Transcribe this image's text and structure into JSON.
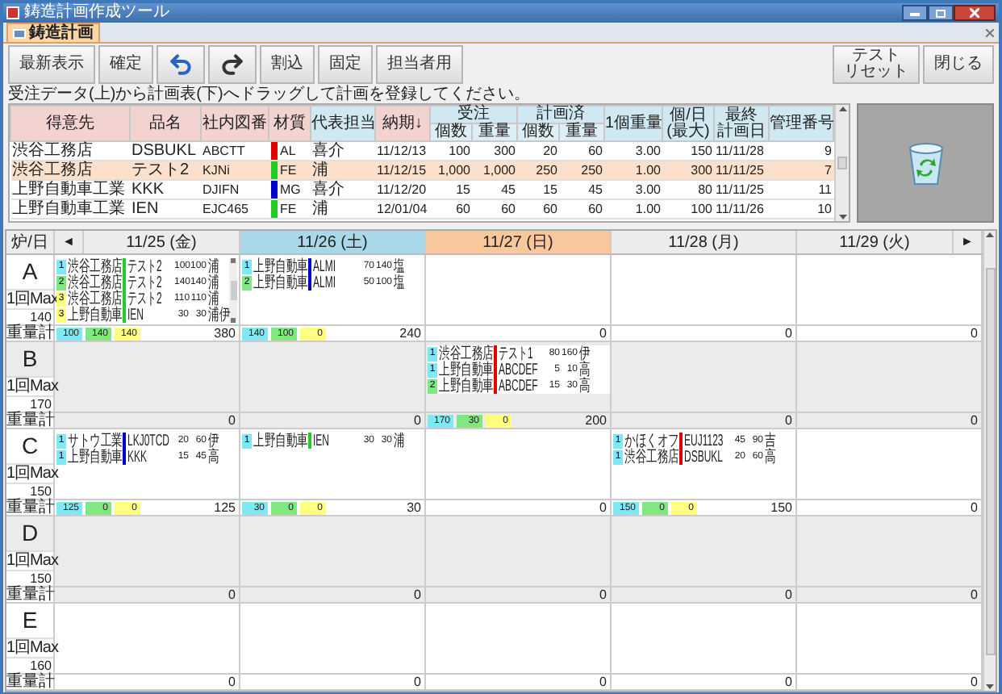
{
  "window": {
    "title": "鋳造計画作成ツール"
  },
  "tabs": [
    {
      "label": "鋳造計画",
      "selected": true
    }
  ],
  "toolbar": {
    "left": [
      {
        "kind": "text",
        "label": "最新表示"
      },
      {
        "kind": "text",
        "label": "確定"
      },
      {
        "kind": "undo"
      },
      {
        "kind": "redo"
      },
      {
        "kind": "text",
        "label": "割込"
      },
      {
        "kind": "text",
        "label": "固定"
      },
      {
        "kind": "text",
        "label": "担当者用"
      }
    ],
    "right": [
      {
        "kind": "text",
        "lines": [
          "テスト",
          "リセット"
        ]
      },
      {
        "kind": "text",
        "lines": [
          "閉じる"
        ]
      }
    ]
  },
  "instruction": "受注データ(上)から計画表(下)へドラッグして計画を登録してください。",
  "orders": {
    "columns": [
      {
        "lines": [
          "得意先"
        ],
        "color": "#f2d3d0"
      },
      {
        "lines": [
          "品名"
        ],
        "color": "#f2d3d0"
      },
      {
        "lines": [
          "社内図番"
        ],
        "color": "#f2d3d0"
      },
      {
        "lines": [
          "材質"
        ],
        "color": "#f2d3d0"
      },
      {
        "lines": [
          "代表担当"
        ],
        "color": "#cfe8f2"
      },
      {
        "lines": [
          "納期↓"
        ],
        "color": "#f2d3d0"
      },
      {
        "lines": [
          "受注"
        ],
        "color": "#cfe8f2",
        "colspan": 2,
        "children": [
          {
            "lines": [
              "個数"
            ],
            "color": "#dceff7"
          },
          {
            "lines": [
              "重量"
            ],
            "color": "#dceff7"
          }
        ]
      },
      {
        "lines": [
          "計画済"
        ],
        "color": "#cfe8f2",
        "colspan": 2,
        "children": [
          {
            "lines": [
              "個数"
            ],
            "color": "#dceff7"
          },
          {
            "lines": [
              "重量"
            ],
            "color": "#dceff7"
          }
        ]
      },
      {
        "lines": [
          "1個重量"
        ],
        "color": "#cfe8f2"
      },
      {
        "lines": [
          "個/日",
          "(最大)"
        ],
        "color": "#cfe8f2"
      },
      {
        "lines": [
          "最終",
          "計画日"
        ],
        "color": "#cfe8f2"
      },
      {
        "lines": [
          "管理番号"
        ],
        "color": "#cfe8f2"
      }
    ],
    "rows": [
      {
        "cells": [
          "渋谷工務店",
          "DSBUKL",
          "ABCTT",
          "AL",
          "喜介",
          "11/12/13",
          "100",
          "300",
          "20",
          "60",
          "3.00",
          "150",
          "11/11/28",
          "9"
        ],
        "color": "#e00000",
        "selected": false
      },
      {
        "cells": [
          "渋谷工務店",
          "テスト2",
          "KJNi",
          "FE",
          "浦",
          "11/12/15",
          "1,000",
          "1,000",
          "250",
          "250",
          "1.00",
          "300",
          "11/11/25",
          "7"
        ],
        "color": "#22cc22",
        "selected": true
      },
      {
        "cells": [
          "上野自動車工業",
          "KKK",
          "DJIFN",
          "MG",
          "喜介",
          "11/12/20",
          "15",
          "45",
          "15",
          "45",
          "3.00",
          "80",
          "11/11/25",
          "11"
        ],
        "color": "#0000cc",
        "selected": false
      },
      {
        "cells": [
          "上野自動車工業",
          "IEN",
          "EJC465",
          "FE",
          "浦",
          "12/01/04",
          "60",
          "60",
          "60",
          "60",
          "1.00",
          "100",
          "11/11/26",
          "10"
        ],
        "color": "#22cc22",
        "selected": false
      }
    ]
  },
  "plan": {
    "corner": "炉/日",
    "prev": "◄",
    "next": "►",
    "days": [
      {
        "label": "11/25 (金)",
        "color": "#ececec"
      },
      {
        "label": "11/26 (土)",
        "color": "#a9d9e9"
      },
      {
        "label": "11/27 (日)",
        "color": "#f8c79c"
      },
      {
        "label": "11/28 (月)",
        "color": "#ececec"
      },
      {
        "label": "11/29 (火)",
        "color": "#ececec"
      }
    ],
    "rows": [
      {
        "name": "A",
        "max_label": "1回Max",
        "max": "140",
        "total_label": "重量計",
        "cells": [
          {
            "entries": [
              {
                "badge": {
                  "label": "1",
                  "color": "#80e8f2"
                },
                "customer": "渋谷工務店",
                "material": {
                  "color": "#22cc22"
                },
                "product": "テスト2",
                "qty": "100",
                "weight": "100",
                "handler": "浦"
              },
              {
                "badge": {
                  "label": "2",
                  "color": "#80e880"
                },
                "customer": "渋谷工務店",
                "material": {
                  "color": "#22cc22"
                },
                "product": "テスト2",
                "qty": "140",
                "weight": "140",
                "handler": "浦"
              },
              {
                "badge": {
                  "label": "3",
                  "color": "#ffff80"
                },
                "customer": "渋谷工務店",
                "material": {
                  "color": "#22cc22"
                },
                "product": "テスト2",
                "qty": "110",
                "weight": "110",
                "handler": "浦"
              },
              {
                "badge": {
                  "label": "3",
                  "color": "#ffff80"
                },
                "customer": "上野自動車",
                "material": {
                  "color": "#22cc22"
                },
                "product": "IEN",
                "qty": "30",
                "weight": "30",
                "handler": "浦伊"
              }
            ],
            "chips": [
              {
                "value": "100",
                "color": "#80e8f2"
              },
              {
                "value": "140",
                "color": "#80e880"
              },
              {
                "value": "140",
                "color": "#ffff80"
              }
            ],
            "total": "380"
          },
          {
            "entries": [
              {
                "badge": {
                  "label": "1",
                  "color": "#80e8f2"
                },
                "customer": "上野自動車",
                "material": {
                  "color": "#0000cc"
                },
                "product": "ALMI",
                "qty": "70",
                "weight": "140",
                "handler": "塩"
              },
              {
                "badge": {
                  "label": "2",
                  "color": "#80e880"
                },
                "customer": "上野自動車",
                "material": {
                  "color": "#0000cc"
                },
                "product": "ALMI",
                "qty": "50",
                "weight": "100",
                "handler": "塩"
              }
            ],
            "chips": [
              {
                "value": "140",
                "color": "#80e8f2"
              },
              {
                "value": "100",
                "color": "#80e880"
              },
              {
                "value": "0",
                "color": "#ffff80"
              }
            ],
            "total": "240"
          },
          {
            "total": "0"
          },
          {
            "total": "0"
          },
          {
            "total": "0"
          }
        ]
      },
      {
        "name": "B",
        "max_label": "1回Max",
        "max": "170",
        "total_label": "重量計",
        "cells": [
          {
            "total": "0"
          },
          {
            "total": "0"
          },
          {
            "entries": [
              {
                "badge": {
                  "label": "1",
                  "color": "#80e8f2"
                },
                "customer": "渋谷工務店",
                "material": {
                  "color": "#e00000"
                },
                "product": "テスト1",
                "qty": "80",
                "weight": "160",
                "handler": "伊"
              },
              {
                "badge": {
                  "label": "1",
                  "color": "#80e8f2"
                },
                "customer": "上野自動車",
                "material": {
                  "color": "#e00000"
                },
                "product": "ABCDEF",
                "qty": "5",
                "weight": "10",
                "handler": "高"
              },
              {
                "badge": {
                  "label": "2",
                  "color": "#80e880"
                },
                "customer": "上野自動車",
                "material": {
                  "color": "#e00000"
                },
                "product": "ABCDEF",
                "qty": "15",
                "weight": "30",
                "handler": "高"
              }
            ],
            "chips": [
              {
                "value": "170",
                "color": "#80e8f2"
              },
              {
                "value": "30",
                "color": "#80e880"
              },
              {
                "value": "0",
                "color": "#ffff80"
              }
            ],
            "total": "200"
          },
          {
            "total": "0"
          },
          {
            "total": "0"
          }
        ]
      },
      {
        "name": "C",
        "max_label": "1回Max",
        "max": "150",
        "total_label": "重量計",
        "cells": [
          {
            "entries": [
              {
                "badge": {
                  "label": "1",
                  "color": "#80e8f2"
                },
                "customer": "サトウ工業",
                "material": {
                  "color": "#0000cc"
                },
                "product": "LKJ0TCD",
                "qty": "20",
                "weight": "60",
                "handler": "伊"
              },
              {
                "badge": {
                  "label": "1",
                  "color": "#80e8f2"
                },
                "customer": "上野自動車",
                "material": {
                  "color": "#0000cc"
                },
                "product": "KKK",
                "qty": "15",
                "weight": "45",
                "handler": "高"
              }
            ],
            "chips": [
              {
                "value": "125",
                "color": "#80e8f2"
              },
              {
                "value": "0",
                "color": "#80e880"
              },
              {
                "value": "0",
                "color": "#ffff80"
              }
            ],
            "total": "125"
          },
          {
            "entries": [
              {
                "badge": {
                  "label": "1",
                  "color": "#80e8f2"
                },
                "customer": "上野自動車",
                "material": {
                  "color": "#22cc22"
                },
                "product": "IEN",
                "qty": "30",
                "weight": "30",
                "handler": "浦"
              }
            ],
            "chips": [
              {
                "value": "30",
                "color": "#80e8f2"
              },
              {
                "value": "0",
                "color": "#80e880"
              },
              {
                "value": "0",
                "color": "#ffff80"
              }
            ],
            "total": "30"
          },
          {
            "total": "0"
          },
          {
            "entries": [
              {
                "badge": {
                  "label": "1",
                  "color": "#80e8f2"
                },
                "customer": "かほくオフ",
                "material": {
                  "color": "#e00000"
                },
                "product": "EUJ1123",
                "qty": "45",
                "weight": "90",
                "handler": "吉"
              },
              {
                "badge": {
                  "label": "1",
                  "color": "#80e8f2"
                },
                "customer": "渋谷工務店",
                "material": {
                  "color": "#e00000"
                },
                "product": "DSBUKL",
                "qty": "20",
                "weight": "60",
                "handler": "高"
              }
            ],
            "chips": [
              {
                "value": "150",
                "color": "#80e8f2"
              },
              {
                "value": "0",
                "color": "#80e880"
              },
              {
                "value": "0",
                "color": "#ffff80"
              }
            ],
            "total": "150"
          },
          {
            "total": "0"
          }
        ]
      },
      {
        "name": "D",
        "max_label": "1回Max",
        "max": "150",
        "total_label": "重量計",
        "cells": [
          {
            "total": "0"
          },
          {
            "total": "0"
          },
          {
            "total": "0"
          },
          {
            "total": "0"
          },
          {
            "total": "0"
          }
        ]
      },
      {
        "name": "E",
        "max_label": "1回Max",
        "max": "160",
        "total_label": "重量計",
        "cells": [
          {
            "total": "0"
          },
          {
            "total": "0"
          },
          {
            "total": "0"
          },
          {
            "total": "0"
          },
          {
            "total": "0"
          }
        ]
      }
    ]
  }
}
